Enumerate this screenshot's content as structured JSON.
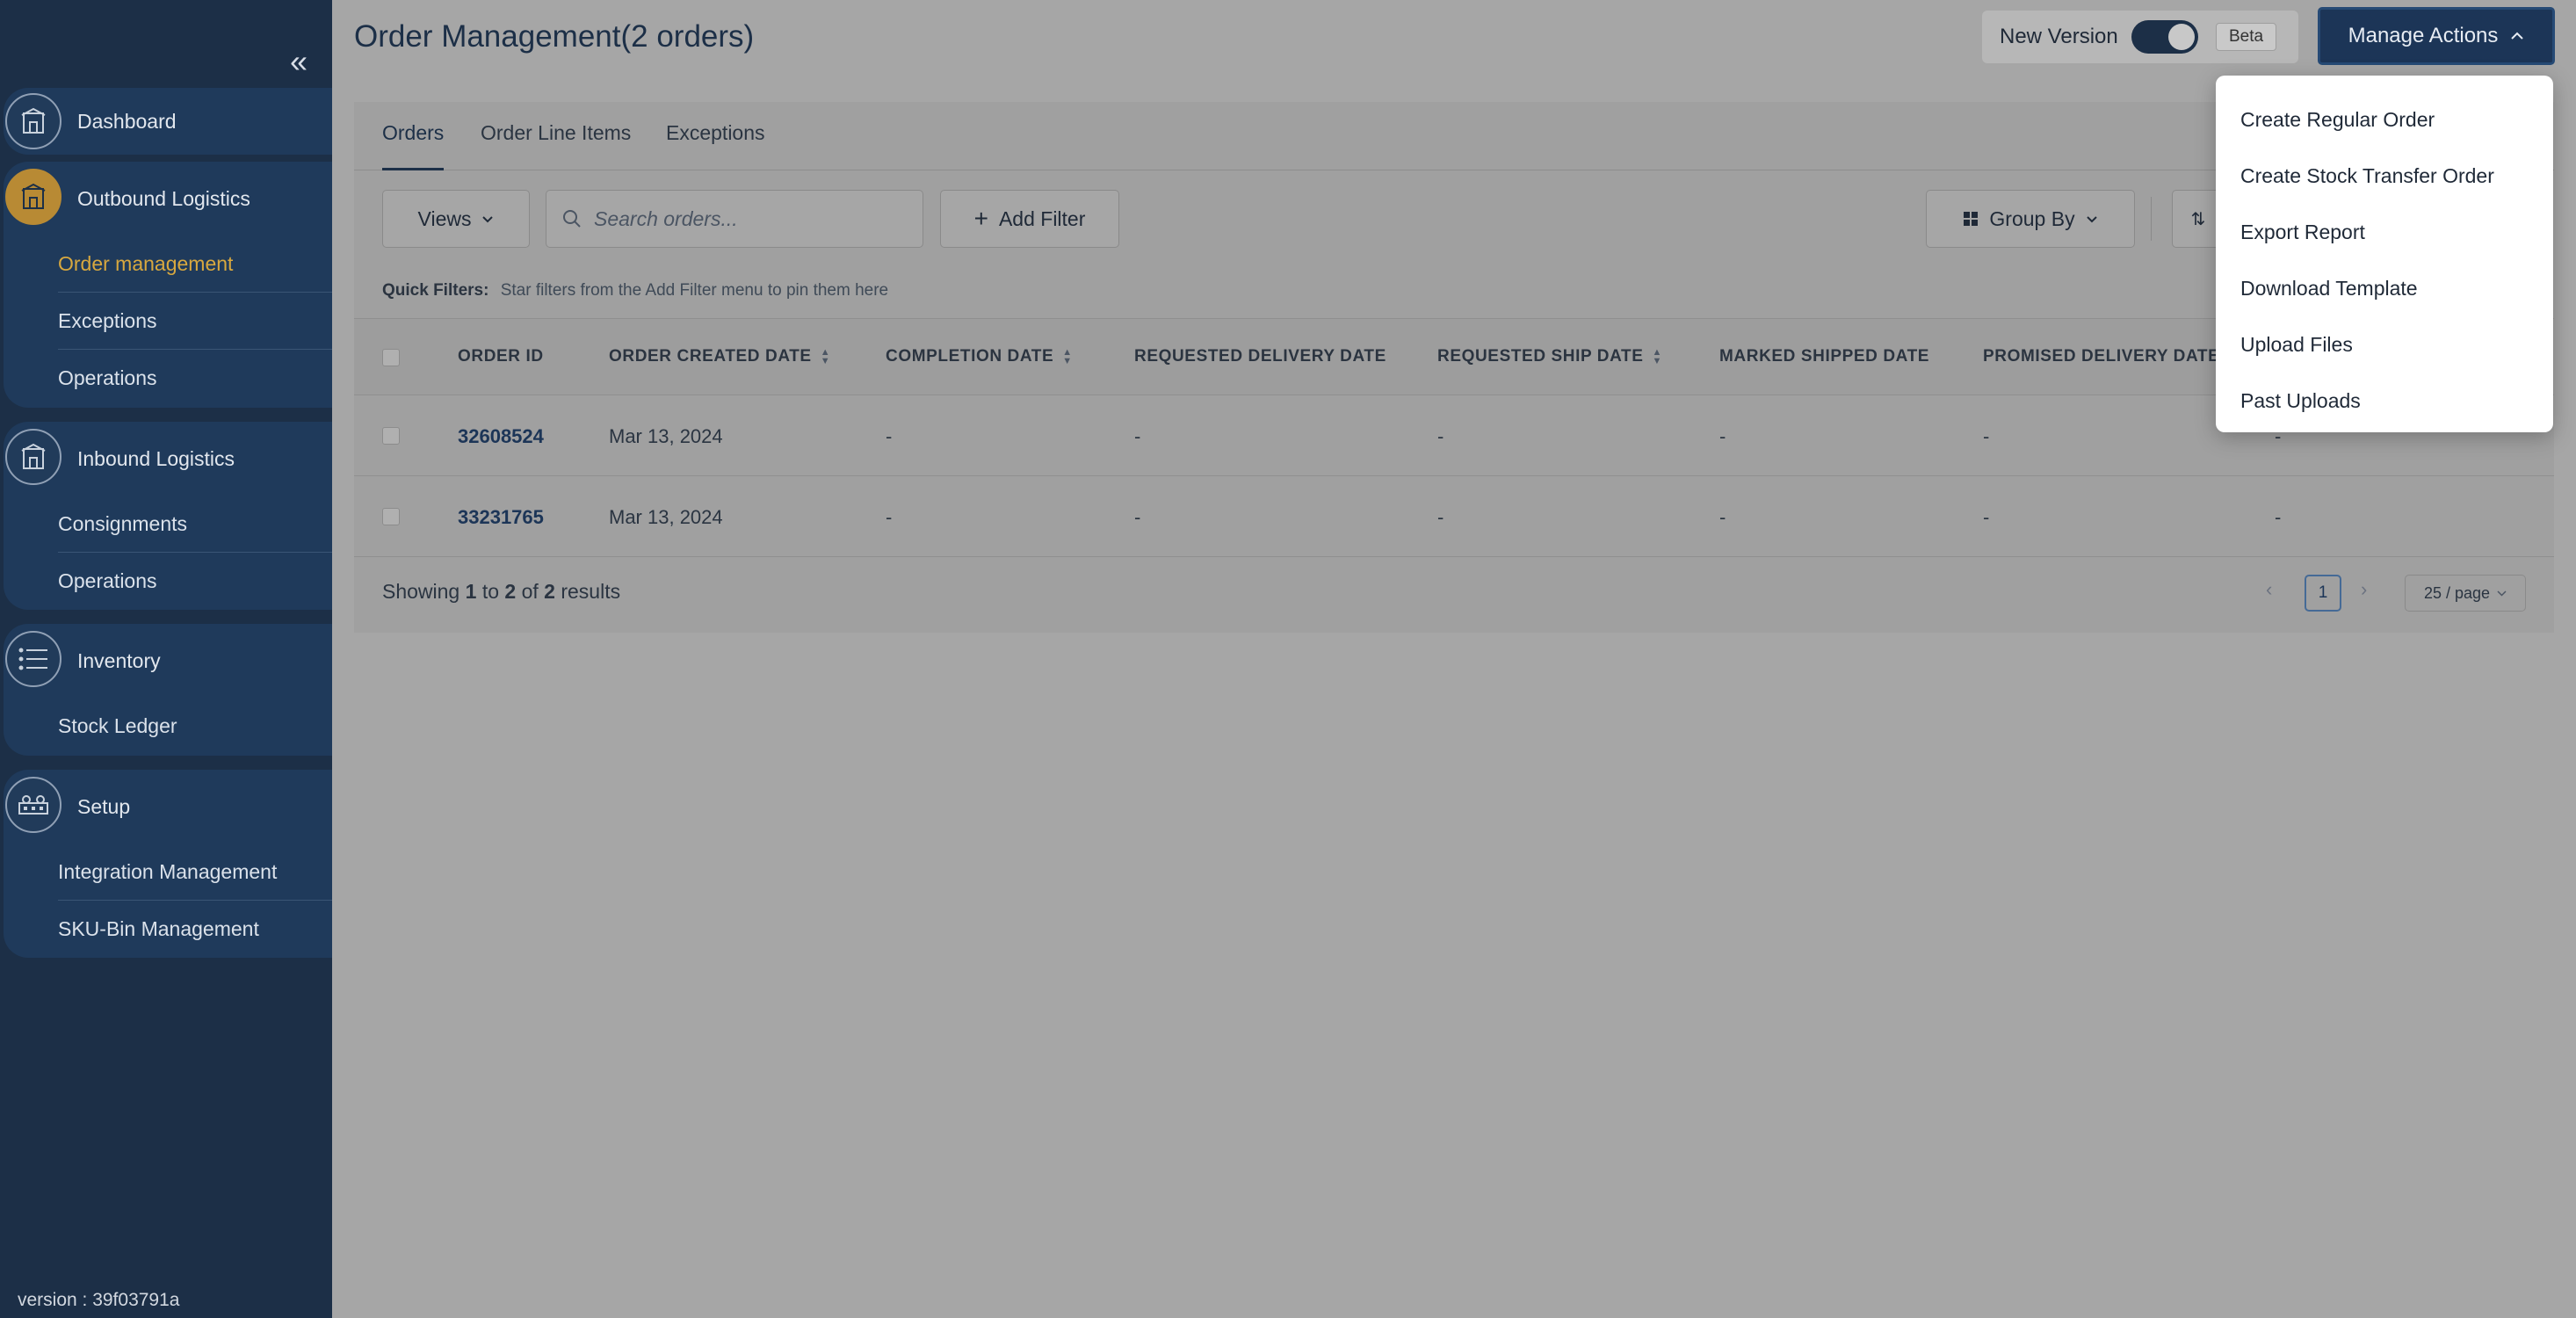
{
  "sidebar": {
    "groups": [
      {
        "title": "Dashboard",
        "icon": "building-icon",
        "items": []
      },
      {
        "title": "Outbound Logistics",
        "icon": "building-icon",
        "items": [
          "Order management",
          "Exceptions",
          "Operations"
        ]
      },
      {
        "title": "Inbound Logistics",
        "icon": "building-icon",
        "items": [
          "Consignments",
          "Operations"
        ]
      },
      {
        "title": "Inventory",
        "icon": "list-icon",
        "items": [
          "Stock Ledger"
        ]
      },
      {
        "title": "Setup",
        "icon": "setup-icon",
        "items": [
          "Integration Management",
          "SKU-Bin Management"
        ]
      }
    ],
    "version": "version : 39f03791a"
  },
  "header": {
    "title": "Order Management(2 orders)",
    "new_version_label": "New Version",
    "beta_label": "Beta",
    "manage_actions_label": "Manage Actions"
  },
  "tabs": [
    "Orders",
    "Order Line Items",
    "Exceptions"
  ],
  "toolbar": {
    "views_label": "Views",
    "search_placeholder": "Search orders...",
    "add_filter_label": "Add Filter",
    "group_by_label": "Group By"
  },
  "quick_filters": {
    "label": "Quick Filters:",
    "hint": "Star filters from the Add Filter menu to pin them here"
  },
  "table": {
    "columns": [
      "ORDER ID",
      "ORDER CREATED DATE",
      "COMPLETION DATE",
      "REQUESTED DELIVERY DATE",
      "REQUESTED SHIP DATE",
      "MARKED SHIPPED DATE",
      "PROMISED DELIVERY DATE"
    ],
    "rows": [
      [
        "32608524",
        "Mar 13, 2024",
        "-",
        "-",
        "-",
        "-",
        "-",
        "-"
      ],
      [
        "33231765",
        "Mar 13, 2024",
        "-",
        "-",
        "-",
        "-",
        "-",
        "-"
      ]
    ]
  },
  "footer": {
    "showing": "Showing",
    "from": "1",
    "to_word": "to",
    "to": "2",
    "of_word": "of",
    "total": "2",
    "results": "results",
    "page": "1",
    "per_page": "25 / page"
  },
  "menu": {
    "items": [
      "Create Regular Order",
      "Create Stock Transfer Order",
      "Export Report",
      "Download Template",
      "Upload Files",
      "Past Uploads"
    ]
  }
}
